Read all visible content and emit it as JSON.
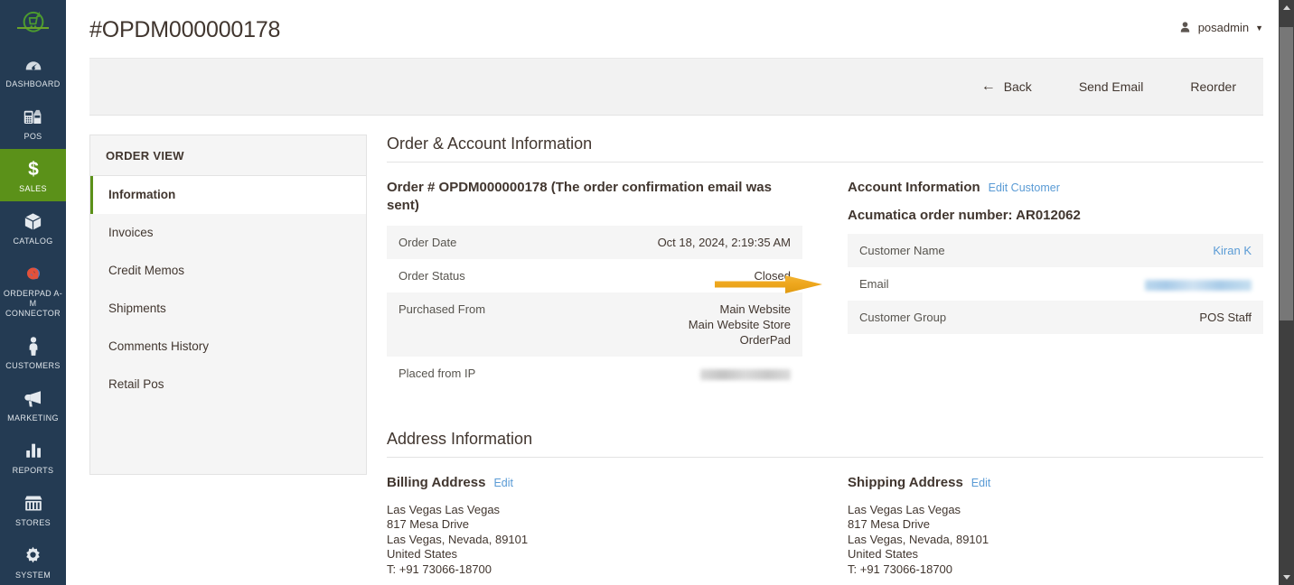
{
  "sidenav": {
    "logo": "magento-cart-logo",
    "items": [
      {
        "id": "dashboard",
        "label": "DASHBOARD",
        "icon": "dashboard-gauge-icon",
        "active": false
      },
      {
        "id": "pos",
        "label": "POS",
        "icon": "pos-terminal-icon",
        "active": false
      },
      {
        "id": "sales",
        "label": "SALES",
        "icon": "dollar-sign-icon",
        "active": true
      },
      {
        "id": "catalog",
        "label": "CATALOG",
        "icon": "box-icon",
        "active": false
      },
      {
        "id": "orderpad-connector",
        "label": "ORDERPAD A-M CONNECTOR",
        "icon": "infinity-link-icon",
        "active": false
      },
      {
        "id": "customers",
        "label": "CUSTOMERS",
        "icon": "person-icon",
        "active": false
      },
      {
        "id": "marketing",
        "label": "MARKETING",
        "icon": "megaphone-icon",
        "active": false
      },
      {
        "id": "reports",
        "label": "REPORTS",
        "icon": "bar-chart-icon",
        "active": false
      },
      {
        "id": "stores",
        "label": "STORES",
        "icon": "storefront-icon",
        "active": false
      },
      {
        "id": "system",
        "label": "SYSTEM",
        "icon": "gear-icon",
        "active": false
      }
    ]
  },
  "header": {
    "title": "#OPDM000000178",
    "user": {
      "name": "posadmin",
      "avatar_icon": "user-avatar-icon",
      "caret_icon": "chevron-down-icon"
    }
  },
  "actions": {
    "back": "Back",
    "back_icon": "arrow-left-icon",
    "send_email": "Send Email",
    "reorder": "Reorder"
  },
  "order_view": {
    "title": "ORDER VIEW",
    "items": [
      {
        "label": "Information",
        "active": true
      },
      {
        "label": "Invoices",
        "active": false
      },
      {
        "label": "Credit Memos",
        "active": false
      },
      {
        "label": "Shipments",
        "active": false
      },
      {
        "label": "Comments History",
        "active": false
      },
      {
        "label": "Retail Pos",
        "active": false
      }
    ]
  },
  "order_account_section": {
    "title": "Order & Account Information",
    "order": {
      "heading": "Order # OPDM000000178 (The order confirmation email was sent)",
      "rows": [
        {
          "label": "Order Date",
          "value": "Oct 18, 2024, 2:19:35 AM",
          "type": "text"
        },
        {
          "label": "Order Status",
          "value": "Closed",
          "type": "text"
        },
        {
          "label": "Purchased From",
          "value": [
            "Main Website",
            "Main Website Store",
            "OrderPad"
          ],
          "type": "multi"
        },
        {
          "label": "Placed from IP",
          "value": "",
          "type": "redacted-gray"
        }
      ]
    },
    "account": {
      "heading": "Account Information",
      "edit_customer_link": "Edit Customer",
      "acumatica": "Acumatica order number: AR012062",
      "rows": [
        {
          "label": "Customer Name",
          "value": "Kiran K",
          "type": "link"
        },
        {
          "label": "Email",
          "value": "",
          "type": "redacted-blue"
        },
        {
          "label": "Customer Group",
          "value": "POS Staff",
          "type": "text"
        }
      ]
    }
  },
  "address_section": {
    "title": "Address Information",
    "billing": {
      "heading": "Billing Address",
      "edit_link": "Edit",
      "lines": [
        "Las Vegas Las Vegas",
        "817 Mesa Drive",
        "Las Vegas, Nevada, 89101",
        "United States",
        "T: +91 73066-18700"
      ]
    },
    "shipping": {
      "heading": "Shipping Address",
      "edit_link": "Edit",
      "lines": [
        "Las Vegas Las Vegas",
        "817 Mesa Drive",
        "Las Vegas, Nevada, 89101",
        "United States",
        "T: +91 73066-18700"
      ]
    }
  },
  "annotation": {
    "arrow_icon": "orange-right-arrow-annotation",
    "color": "#efa81e",
    "points_to": "Closed"
  },
  "scrollbar": {
    "up_icon": "scroll-up-arrow-icon",
    "down_icon": "scroll-down-arrow-icon",
    "thumb": "scroll-thumb"
  },
  "colors": {
    "sidenav_bg": "#243b53",
    "accent_green": "#5b9119",
    "link_blue": "#5a9bd5",
    "annotation_orange": "#efa81e",
    "row_stripe": "#f5f5f5"
  }
}
